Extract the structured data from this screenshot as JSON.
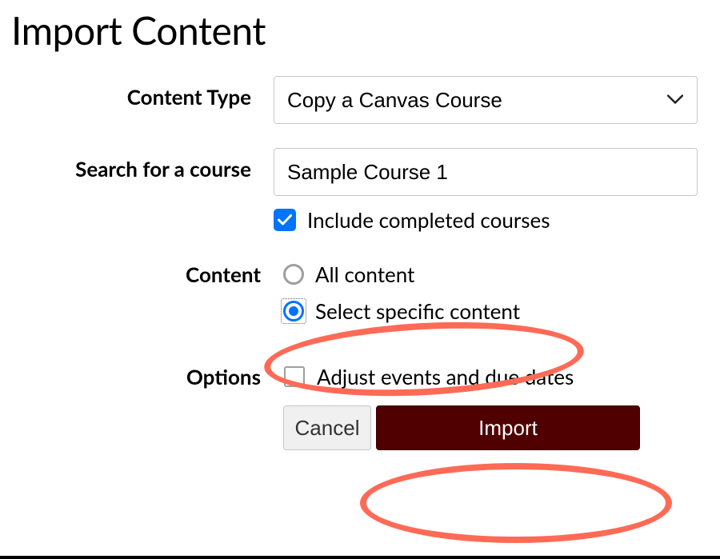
{
  "page_title": "Import Content",
  "labels": {
    "content_type": "Content Type",
    "search_course": "Search for a course",
    "content": "Content",
    "options": "Options"
  },
  "content_type": {
    "selected": "Copy a Canvas Course"
  },
  "search": {
    "value": "Sample Course 1",
    "include_completed_label": "Include completed courses",
    "include_completed_checked": true
  },
  "content_radios": {
    "all_label": "All content",
    "specific_label": "Select specific content",
    "selected": "specific"
  },
  "options": {
    "adjust_dates_label": "Adjust events and due dates",
    "adjust_dates_checked": false
  },
  "buttons": {
    "cancel": "Cancel",
    "import": "Import"
  }
}
